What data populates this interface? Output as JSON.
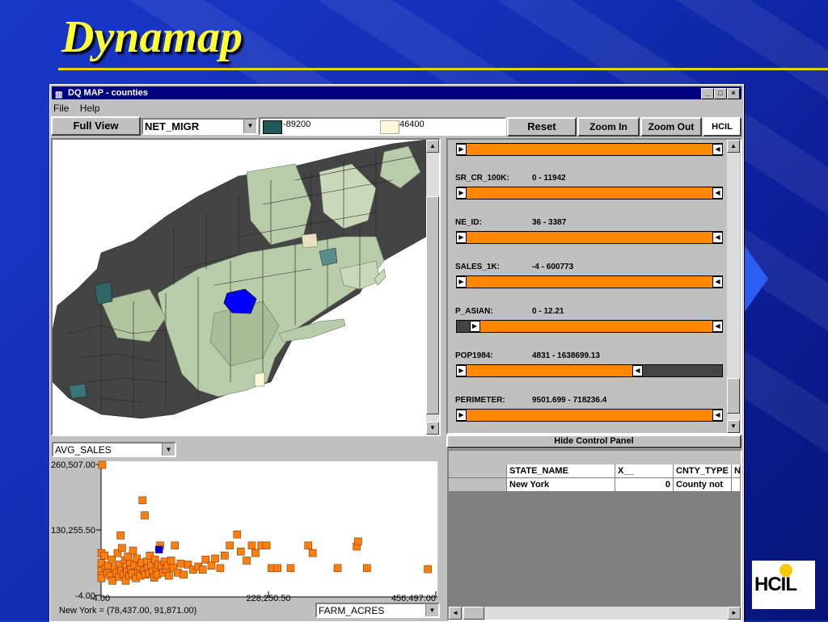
{
  "slide": {
    "title": "Dynamap"
  },
  "window": {
    "title": "DQ MAP - counties",
    "app_icon": "map-icon",
    "controls": {
      "minimize": "_",
      "maximize": "□",
      "close": "×"
    }
  },
  "menu": {
    "items": [
      "File",
      "Help"
    ]
  },
  "toolbar": {
    "full_view_label": "Full View",
    "attribute_value": "NET_MIGR",
    "legend_min": "-89200",
    "legend_max": "46400",
    "legend_min_color": "#1e5a5a",
    "legend_max_color": "#fff8d8",
    "reset_label": "Reset",
    "zoom_in_label": "Zoom In",
    "zoom_out_label": "Zoom Out",
    "logo_text": "HCIL"
  },
  "sliders": [
    {
      "name": "",
      "range": "",
      "low_frac": 0.0,
      "high_frac": 1.0
    },
    {
      "name": "SR_CR_100K:",
      "range": "0 - 11942",
      "low_frac": 0.0,
      "high_frac": 1.0
    },
    {
      "name": "NE_ID:",
      "range": "36 - 3387",
      "low_frac": 0.0,
      "high_frac": 1.0
    },
    {
      "name": "SALES_1K:",
      "range": "-4 - 600773",
      "low_frac": 0.0,
      "high_frac": 1.0
    },
    {
      "name": "P_ASIAN:",
      "range": "0 - 12.21",
      "low_frac": 0.05,
      "high_frac": 1.0
    },
    {
      "name": "POP1984:",
      "range": "4831 - 1638699.13",
      "low_frac": 0.0,
      "high_frac": 0.7
    },
    {
      "name": "PERIMETER:",
      "range": "9501.699 - 718236.4",
      "low_frac": 0.0,
      "high_frac": 1.0
    }
  ],
  "control_panel": {
    "hide_label": "Hide Control Panel"
  },
  "table": {
    "columns": [
      "STATE_NAME",
      "X__",
      "CNTY_TYPE",
      "N"
    ],
    "rows": [
      [
        "New York",
        "0",
        "County not",
        ""
      ]
    ]
  },
  "scatter": {
    "y_attribute": "AVG_SALES",
    "x_attribute": "FARM_ACRES",
    "status": "New York = (78,437.00, 91,871.00)",
    "y_ticks": [
      "260,507.00",
      "130,255.50",
      "-4.00"
    ],
    "x_ticks": [
      "-4.00",
      "228,250.50",
      "456,497.00"
    ]
  },
  "chart_data": {
    "type": "scatter",
    "xlabel": "FARM_ACRES",
    "ylabel": "AVG_SALES",
    "xlim": [
      -4,
      456497
    ],
    "ylim": [
      -4,
      260507
    ],
    "series": [
      {
        "color": "#ff7f0e",
        "points": [
          [
            1000,
            260507
          ],
          [
            0,
            85000
          ],
          [
            0,
            65000
          ],
          [
            0,
            50000
          ],
          [
            0,
            40000
          ],
          [
            0,
            35000
          ],
          [
            4000,
            80000
          ],
          [
            6000,
            55000
          ],
          [
            8000,
            45000
          ],
          [
            9000,
            60000
          ],
          [
            12000,
            40000
          ],
          [
            14000,
            72000
          ],
          [
            15000,
            30000
          ],
          [
            18000,
            55000
          ],
          [
            20000,
            45000
          ],
          [
            22000,
            85000
          ],
          [
            24000,
            38000
          ],
          [
            25000,
            62000
          ],
          [
            26000,
            120000
          ],
          [
            27000,
            50000
          ],
          [
            28000,
            95000
          ],
          [
            30000,
            42000
          ],
          [
            32000,
            70000
          ],
          [
            33000,
            30000
          ],
          [
            34000,
            58000
          ],
          [
            35000,
            48000
          ],
          [
            36000,
            78000
          ],
          [
            38000,
            40000
          ],
          [
            39000,
            64000
          ],
          [
            40000,
            52000
          ],
          [
            42000,
            44000
          ],
          [
            43000,
            90000
          ],
          [
            45000,
            60000
          ],
          [
            47000,
            35000
          ],
          [
            48000,
            74000
          ],
          [
            50000,
            48000
          ],
          [
            52000,
            58000
          ],
          [
            53000,
            40000
          ],
          [
            55000,
            66000
          ],
          [
            56000,
            190000
          ],
          [
            58000,
            50000
          ],
          [
            59000,
            160000
          ],
          [
            60000,
            42000
          ],
          [
            62000,
            68000
          ],
          [
            63000,
            56000
          ],
          [
            65000,
            44000
          ],
          [
            66000,
            80000
          ],
          [
            68000,
            60000
          ],
          [
            70000,
            48000
          ],
          [
            72000,
            36000
          ],
          [
            73000,
            72000
          ],
          [
            75000,
            54000
          ],
          [
            76000,
            42000
          ],
          [
            78000,
            62000
          ],
          [
            80000,
            100000
          ],
          [
            82000,
            58000
          ],
          [
            84000,
            46000
          ],
          [
            86000,
            68000
          ],
          [
            88000,
            52000
          ],
          [
            90000,
            60000
          ],
          [
            92000,
            40000
          ],
          [
            95000,
            70000
          ],
          [
            98000,
            56000
          ],
          [
            100000,
            100000
          ],
          [
            104000,
            46000
          ],
          [
            108000,
            64000
          ],
          [
            112000,
            42000
          ],
          [
            118000,
            62000
          ],
          [
            125000,
            52000
          ],
          [
            132000,
            58000
          ],
          [
            138000,
            52000
          ],
          [
            142000,
            72000
          ],
          [
            150000,
            60000
          ],
          [
            155000,
            74000
          ],
          [
            162000,
            55000
          ],
          [
            168000,
            80000
          ],
          [
            175000,
            100000
          ],
          [
            185000,
            122000
          ],
          [
            190000,
            88000
          ],
          [
            198000,
            70000
          ],
          [
            205000,
            100000
          ],
          [
            210000,
            85000
          ],
          [
            218000,
            100000
          ],
          [
            225000,
            100000
          ],
          [
            232000,
            55000
          ],
          [
            240000,
            55000
          ],
          [
            258000,
            55000
          ],
          [
            282000,
            100000
          ],
          [
            288000,
            85000
          ],
          [
            322000,
            55000
          ],
          [
            348000,
            98000
          ],
          [
            350000,
            108000
          ],
          [
            362000,
            55000
          ],
          [
            445000,
            53000
          ]
        ]
      },
      {
        "color": "#0000cc",
        "points": [
          [
            78437,
            91871
          ]
        ]
      }
    ]
  }
}
